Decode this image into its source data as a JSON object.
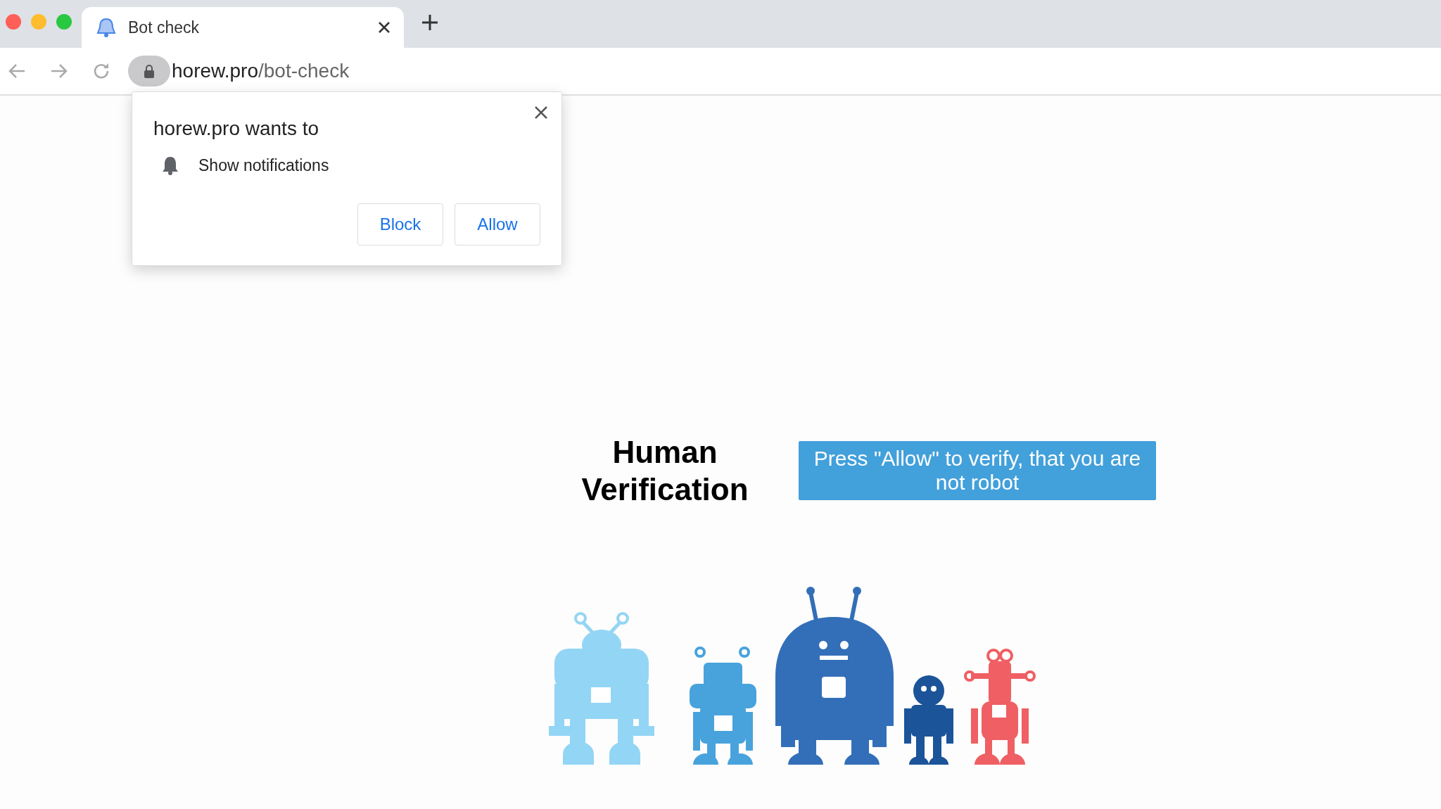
{
  "tab": {
    "title": "Bot check",
    "selected": true
  },
  "address_bar": {
    "host": "horew.pro",
    "path": "/bot-check"
  },
  "permission_popup": {
    "title": "horew.pro wants to",
    "permission": "Show notifications",
    "buttons": [
      "Block",
      "Allow"
    ]
  },
  "page": {
    "heading": "Human Verification",
    "message": "Press \"Allow\" to verify, that you are not robot"
  }
}
